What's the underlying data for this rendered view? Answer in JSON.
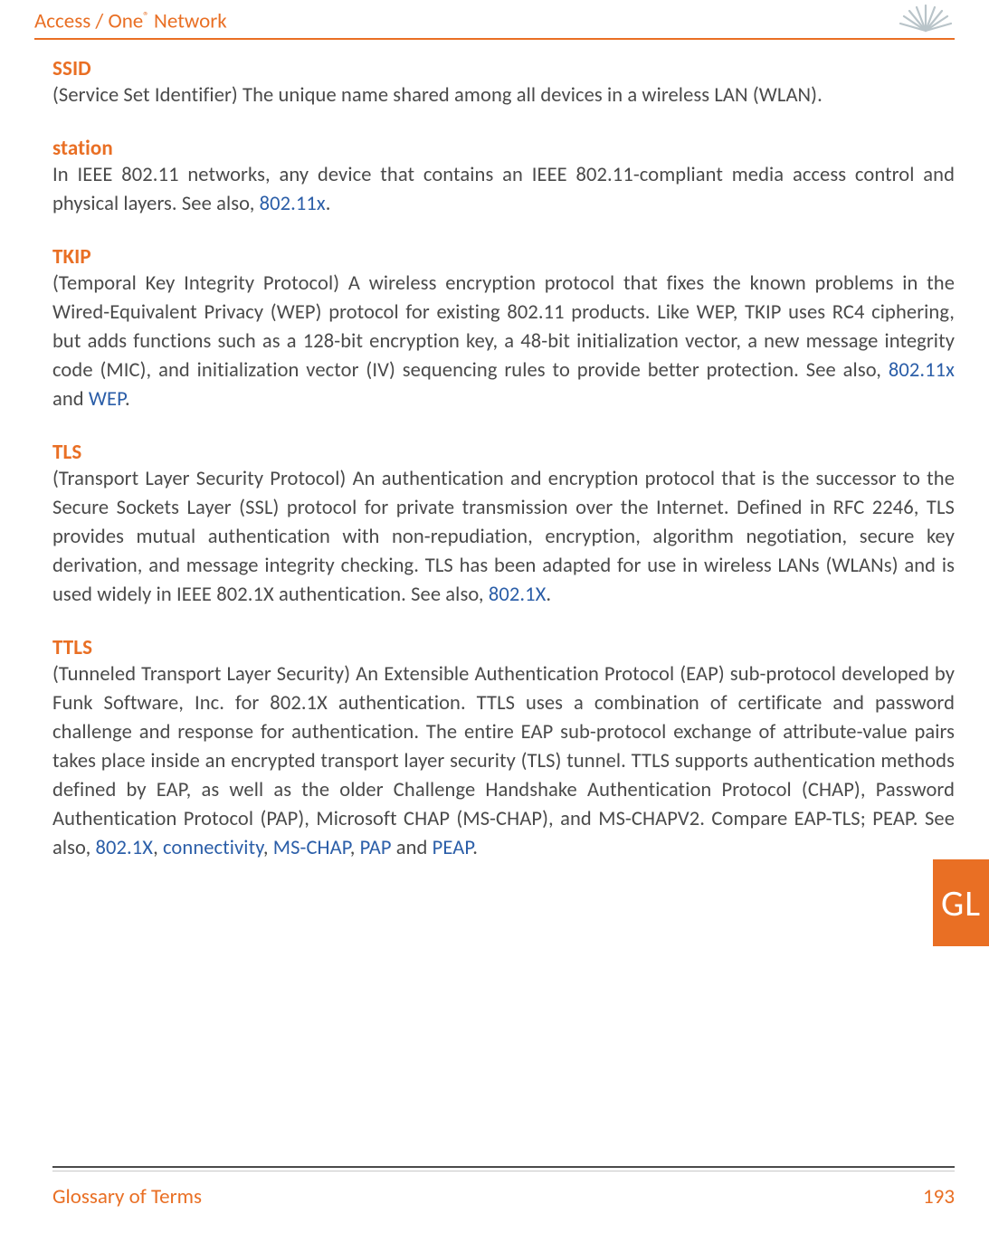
{
  "header": {
    "brand_pre": "Access / One",
    "brand_sup": "®",
    "brand_post": " Network"
  },
  "sideTab": "GL",
  "footer": {
    "title": "Glossary of Terms",
    "page": "193"
  },
  "terms": {
    "ssid": {
      "head": "SSID",
      "body": "(Service Set Identifier) The unique name shared among all devices in a wireless LAN (WLAN)."
    },
    "station": {
      "head": "station",
      "body_pre": "In IEEE 802.11 networks, any device that contains an IEEE 802.11-compliant media access control and physical layers. See also, ",
      "link1": "802.11x",
      "body_post": "."
    },
    "tkip": {
      "head": "TKIP",
      "body_pre": "(Temporal Key Integrity Protocol) A wireless encryption protocol that fixes the known problems in the Wired-Equivalent Privacy (WEP) protocol for existing 802.11 products. Like WEP, TKIP uses RC4 ciphering, but adds functions such as a 128-bit encryption key, a 48-bit initialization vector, a new message integrity code (MIC), and initialization vector (IV) sequencing rules to provide better protection. See also, ",
      "link1": "802.11x",
      "mid": " and ",
      "link2": "WEP",
      "body_post": "."
    },
    "tls": {
      "head": "TLS",
      "body_pre": "(Transport Layer Security Protocol) An authentication and encryption protocol that is the successor to the Secure Sockets Layer (SSL) protocol for private transmission over the Internet. Defined in RFC 2246, TLS provides mutual authentication with non-repudiation, encryption, algorithm negotiation, secure key derivation, and message integrity checking. TLS has been adapted for use in wireless LANs (WLANs) and is used widely in IEEE 802.1X authentication. See also, ",
      "link1": "802.1X",
      "body_post": "."
    },
    "ttls": {
      "head": "TTLS",
      "body_pre": "(Tunneled Transport Layer Security) An Extensible Authentication Protocol (EAP) sub-protocol developed by Funk Software, Inc. for 802.1X authentication. TTLS uses a combination of certificate and password challenge and response for authentication. The entire EAP sub-protocol exchange of attribute-value pairs takes place inside an encrypted transport layer security (TLS) tunnel. TTLS supports authentication methods defined by EAP, as well as the older Challenge Handshake Authentication Protocol (CHAP), Password Authentication Protocol (PAP), Microsoft CHAP (MS-CHAP), and MS-CHAPV2. Compare EAP-TLS; PEAP. See also, ",
      "link1": "802.1X",
      "sep": ", ",
      "link2": "connectivity",
      "link3": "MS-CHAP",
      "link4": "PAP",
      "andword": " and ",
      "link5": "PEAP",
      "body_post": "."
    }
  }
}
